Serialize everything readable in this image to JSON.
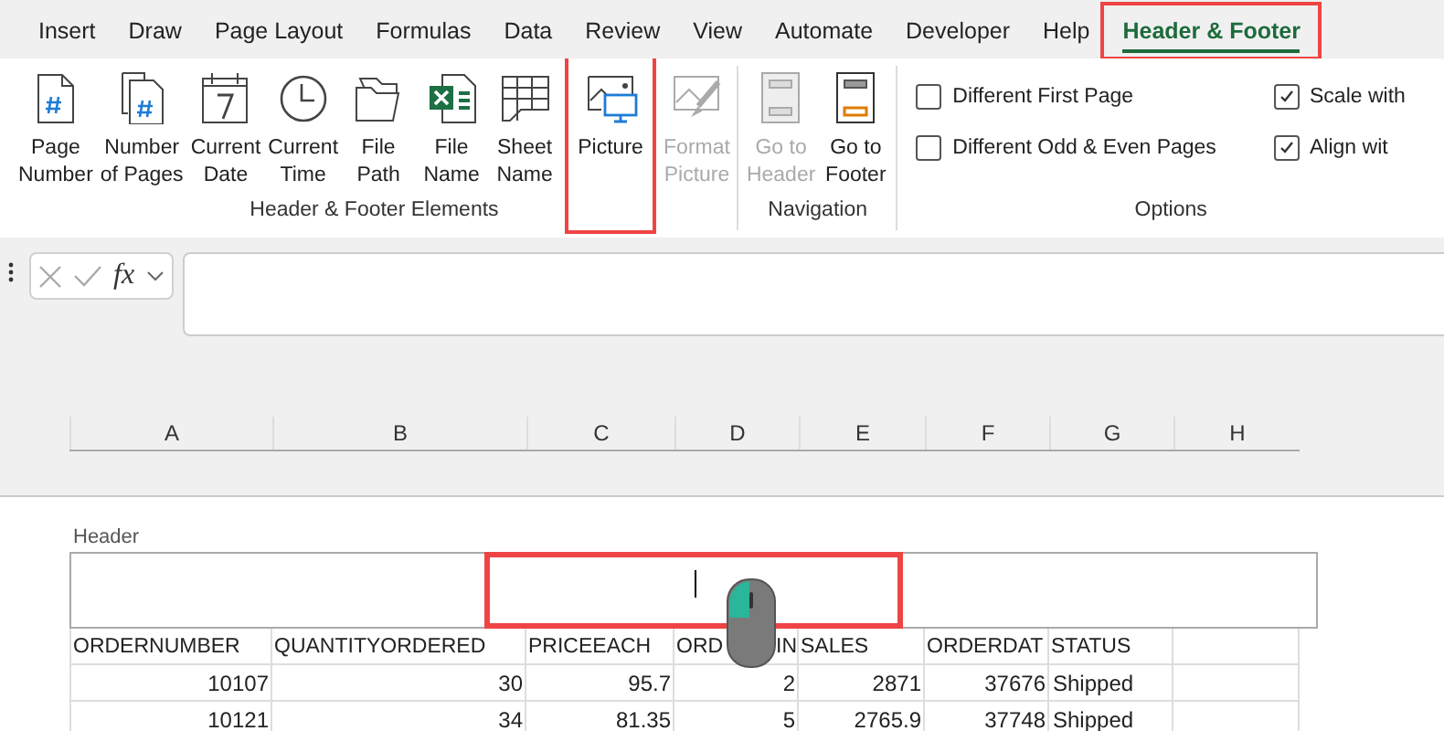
{
  "tabs": [
    {
      "label": "Insert",
      "selected": false,
      "highlighted": false
    },
    {
      "label": "Draw",
      "selected": false,
      "highlighted": false
    },
    {
      "label": "Page Layout",
      "selected": false,
      "highlighted": false
    },
    {
      "label": "Formulas",
      "selected": false,
      "highlighted": false
    },
    {
      "label": "Data",
      "selected": false,
      "highlighted": false
    },
    {
      "label": "Review",
      "selected": false,
      "highlighted": false
    },
    {
      "label": "View",
      "selected": false,
      "highlighted": false
    },
    {
      "label": "Automate",
      "selected": false,
      "highlighted": false
    },
    {
      "label": "Developer",
      "selected": false,
      "highlighted": false
    },
    {
      "label": "Help",
      "selected": false,
      "highlighted": false
    },
    {
      "label": "Header & Footer",
      "selected": true,
      "highlighted": true
    }
  ],
  "ribbon": {
    "groups": [
      {
        "label": "Header & Footer Elements",
        "buttons": [
          {
            "kind": "page-number",
            "label": [
              "Page",
              "Number"
            ],
            "disabled": false,
            "highlighted": false
          },
          {
            "kind": "number-of-pages",
            "label": [
              "Number",
              "of Pages"
            ],
            "disabled": false,
            "highlighted": false
          },
          {
            "kind": "current-date",
            "label": [
              "Current",
              "Date"
            ],
            "disabled": false,
            "highlighted": false
          },
          {
            "kind": "current-time",
            "label": [
              "Current",
              "Time"
            ],
            "disabled": false,
            "highlighted": false
          },
          {
            "kind": "file-path",
            "label": [
              "File",
              "Path"
            ],
            "disabled": false,
            "highlighted": false
          },
          {
            "kind": "file-name",
            "label": [
              "File",
              "Name"
            ],
            "disabled": false,
            "highlighted": false
          },
          {
            "kind": "sheet-name",
            "label": [
              "Sheet",
              "Name"
            ],
            "disabled": false,
            "highlighted": false
          },
          {
            "kind": "picture",
            "label": [
              "Picture"
            ],
            "disabled": false,
            "highlighted": true
          },
          {
            "kind": "format-picture",
            "label": [
              "Format",
              "Picture"
            ],
            "disabled": true,
            "highlighted": false
          }
        ]
      },
      {
        "label": "Navigation",
        "buttons": [
          {
            "kind": "go-to-header",
            "label": [
              "Go to",
              "Header"
            ],
            "disabled": true,
            "highlighted": false
          },
          {
            "kind": "go-to-footer",
            "label": [
              "Go to",
              "Footer"
            ],
            "disabled": false,
            "highlighted": false
          }
        ]
      },
      {
        "label": "Options",
        "checkboxes": [
          {
            "label": "Different First Page",
            "checked": false
          },
          {
            "label": "Different Odd & Even Pages",
            "checked": false
          },
          {
            "label": "Scale with",
            "checked": true
          },
          {
            "label": "Align wit",
            "checked": true
          }
        ]
      }
    ]
  },
  "formula_bar": {
    "function_label": "fx"
  },
  "sheet": {
    "columns": [
      "A",
      "B",
      "C",
      "D",
      "E",
      "F",
      "G",
      "H"
    ],
    "header": {
      "label": "Header",
      "sections": [
        {
          "highlighted": false,
          "cursor": false
        },
        {
          "highlighted": true,
          "cursor": true
        },
        {
          "highlighted": false,
          "cursor": false
        }
      ]
    },
    "heading_row": [
      "ORDERNUMBER",
      "QUANTITYORDERED",
      "PRICEEACH",
      [
        "ORD",
        "IN"
      ],
      "SALES",
      "ORDERDAT",
      "STATUS"
    ],
    "rows": [
      [
        {
          "text": "10107",
          "kind": "number"
        },
        {
          "text": "30",
          "kind": "number"
        },
        {
          "text": "95.7",
          "kind": "number"
        },
        {
          "text": "2",
          "kind": "number"
        },
        {
          "text": "2871",
          "kind": "number"
        },
        {
          "text": "37676",
          "kind": "number"
        },
        {
          "text": "Shipped",
          "kind": "text"
        }
      ],
      [
        {
          "text": "10121",
          "kind": "number"
        },
        {
          "text": "34",
          "kind": "number"
        },
        {
          "text": "81.35",
          "kind": "number"
        },
        {
          "text": "5",
          "kind": "number"
        },
        {
          "text": "2765.9",
          "kind": "number"
        },
        {
          "text": "37748",
          "kind": "number"
        },
        {
          "text": "Shipped",
          "kind": "text"
        }
      ]
    ]
  }
}
